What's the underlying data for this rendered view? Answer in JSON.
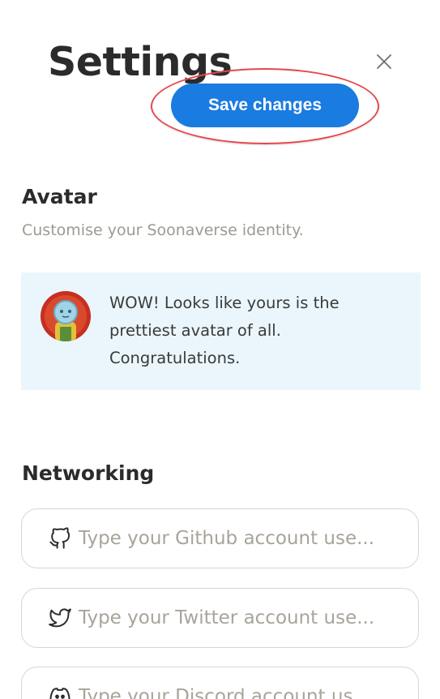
{
  "header": {
    "title": "Settings",
    "save_label": "Save changes"
  },
  "avatar_section": {
    "heading": "Avatar",
    "subtitle": "Customise your Soonaverse identity.",
    "message_line1": "WOW! Looks like yours is the",
    "message_line2": "prettiest avatar of all.",
    "message_line3": "Congratulations."
  },
  "networking_section": {
    "heading": "Networking",
    "fields": [
      {
        "icon": "github-icon",
        "placeholder": "Type your Github account use..."
      },
      {
        "icon": "twitter-icon",
        "placeholder": "Type your Twitter account use..."
      },
      {
        "icon": "discord-icon",
        "placeholder": "Type your Discord account us..."
      }
    ]
  },
  "colors": {
    "accent": "#1a7be0",
    "highlight_ring": "#e5484d",
    "panel_background": "#eaf6fb"
  }
}
